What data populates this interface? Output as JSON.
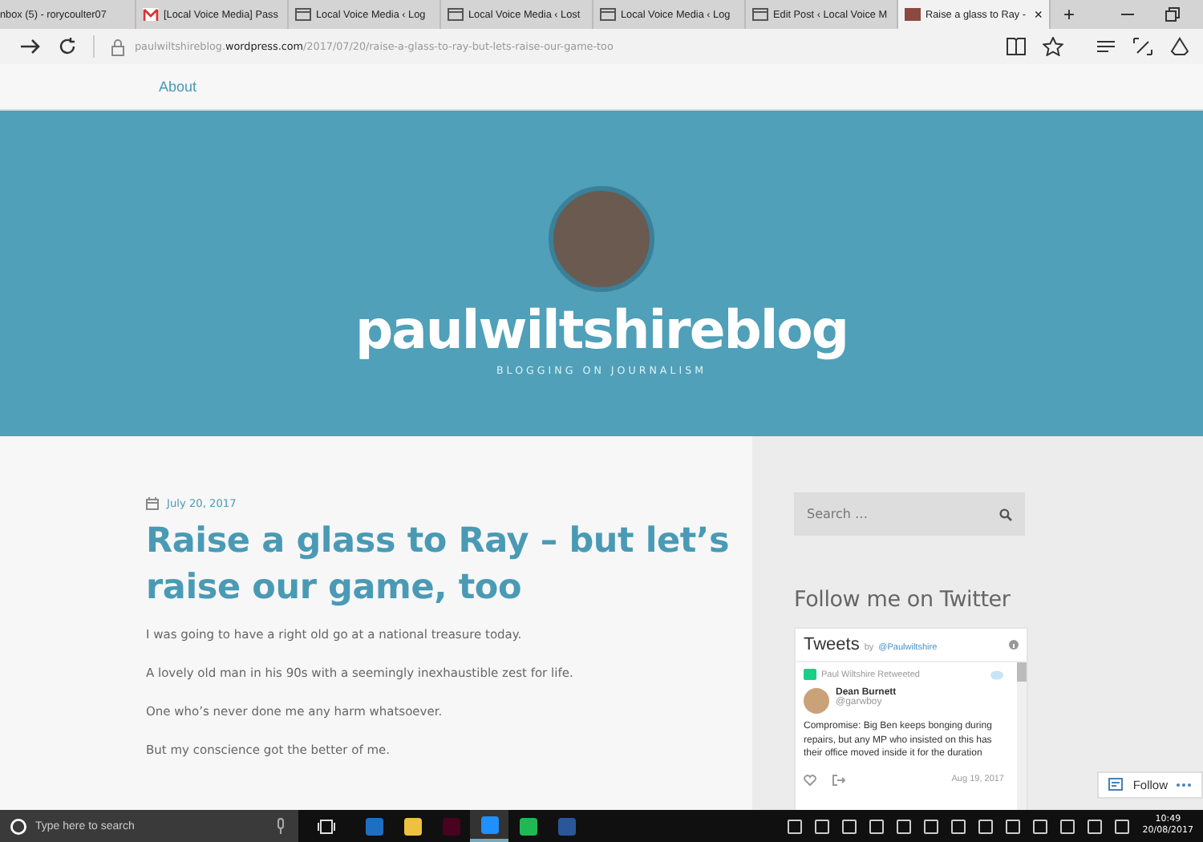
{
  "browser": {
    "tabs": [
      {
        "title": "nbox (5) - rorycoulter07",
        "kind": "none",
        "selected": false
      },
      {
        "title": "[Local Voice Media] Pass",
        "kind": "mail",
        "selected": false
      },
      {
        "title": "Local Voice Media ‹ Log",
        "kind": "page",
        "selected": false
      },
      {
        "title": "Local Voice Media ‹ Lost",
        "kind": "page",
        "selected": false
      },
      {
        "title": "Local Voice Media ‹ Log",
        "kind": "page",
        "selected": false
      },
      {
        "title": "Edit Post ‹ Local Voice M",
        "kind": "page",
        "selected": false
      },
      {
        "title": "Raise a glass to Ray -",
        "kind": "photo",
        "selected": true
      }
    ],
    "close_tab": "×",
    "new_tab": "+",
    "address": {
      "subdomain": "paulwiltshireblog.",
      "domain": "wordpress.com",
      "path": "/2017/07/20/raise-a-glass-to-ray-but-lets-raise-our-game-too"
    }
  },
  "nav": {
    "items": [
      "About"
    ]
  },
  "header": {
    "title": "paulwiltshireblog",
    "tagline": "BLOGGING ON JOURNALISM"
  },
  "post": {
    "date": "July 20, 2017",
    "title": "Raise a glass to Ray – but let’s raise our game, too",
    "paragraphs": [
      "I was going to have a right old go at a national treasure today.",
      "A lovely old man in his 90s with a seemingly inexhaustible zest for life.",
      "One who’s never done me any harm whatsoever.",
      "But my conscience got the better of me."
    ]
  },
  "sidebar": {
    "search": {
      "placeholder": "Search …"
    },
    "twitter_heading": "Follow me on Twitter",
    "widget": {
      "title": "Tweets",
      "by": "by",
      "handle": "@Paulwiltshire",
      "retweeted": "Paul Wiltshire Retweeted",
      "name": "Dean Burnett",
      "username": "@garwboy",
      "text": "Compromise: Big Ben keeps bonging during repairs, but any MP who insisted on this has their office moved inside it for the duration",
      "date": "Aug 19, 2017"
    },
    "follow": "Follow"
  },
  "taskbar": {
    "search_placeholder": "Type here to search",
    "apps": [
      {
        "kind": "outlook",
        "selected": false
      },
      {
        "kind": "folder",
        "selected": false
      },
      {
        "kind": "indesign",
        "selected": false
      },
      {
        "kind": "edge",
        "selected": true
      },
      {
        "kind": "spotify",
        "selected": false
      },
      {
        "kind": "word",
        "selected": false
      }
    ],
    "time": "10:49",
    "date": "20/08/2017"
  }
}
